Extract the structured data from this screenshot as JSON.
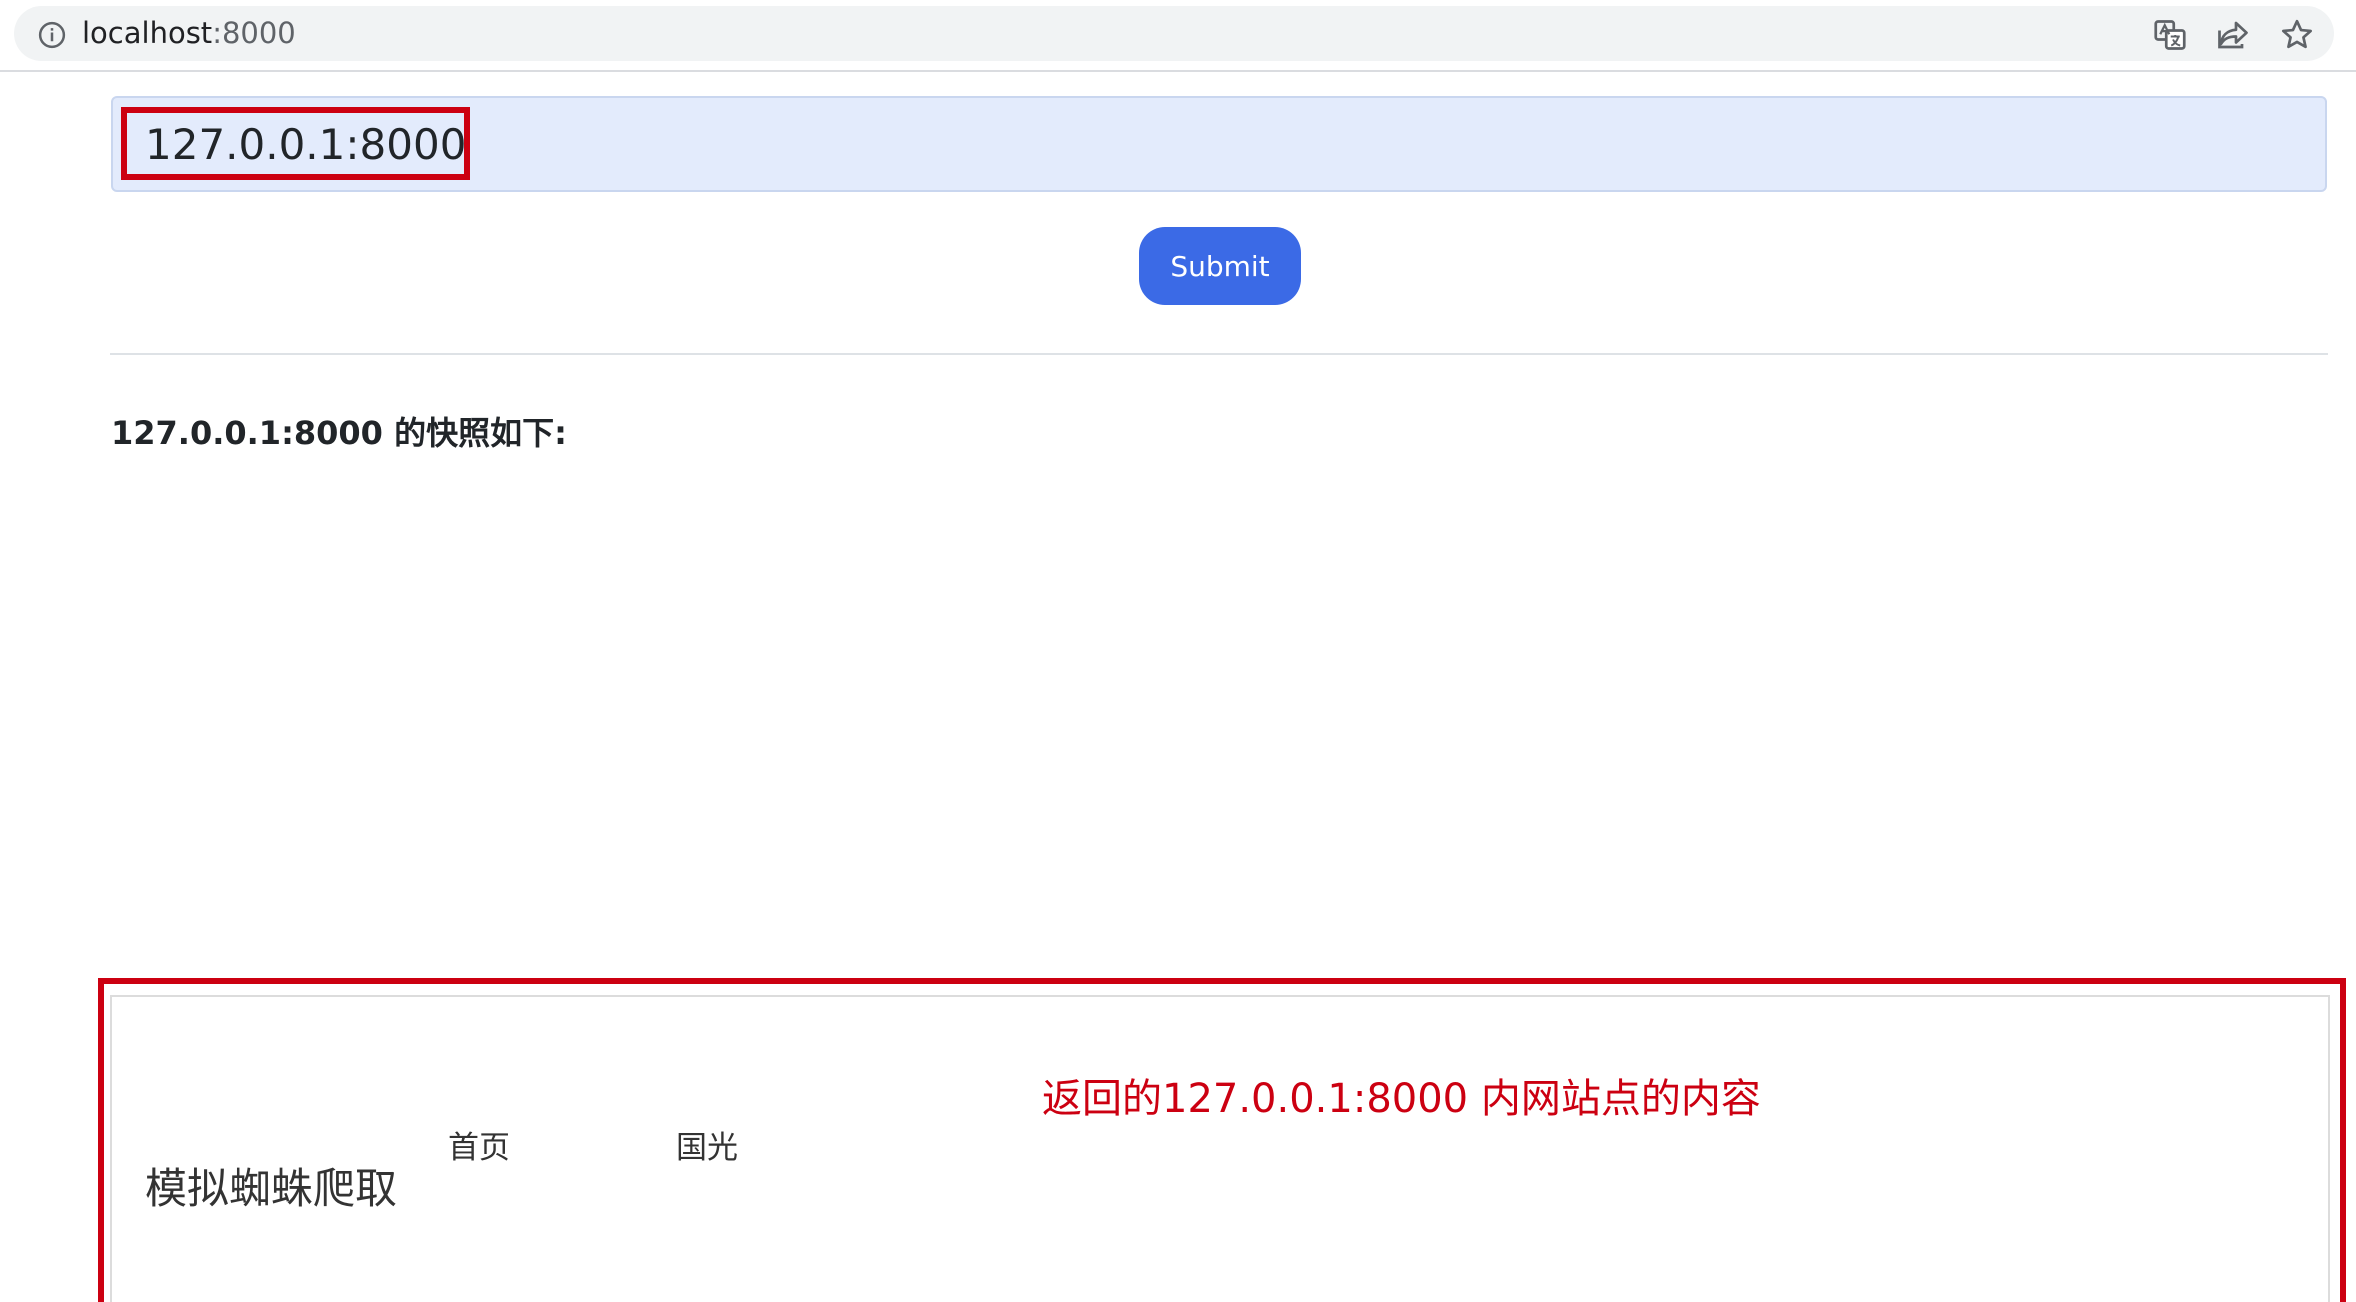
{
  "browser": {
    "url_host": "localhost",
    "url_port": ":8000",
    "icons": [
      "info-icon",
      "translate-icon",
      "share-icon",
      "star-icon"
    ]
  },
  "form": {
    "url_input_value": "127.0.0.1:8000",
    "submit_label": "Submit"
  },
  "result": {
    "heading": "127.0.0.1:8000 的快照如下:"
  },
  "snapshot": {
    "brand": "模拟蜘蛛爬取",
    "nav": [
      "首页",
      "国光"
    ],
    "annotation": "返回的127.0.0.1:8000 内网站点的内容"
  },
  "colors": {
    "accent": "#3b6ae6",
    "highlight": "#cc0011",
    "input_bg": "#e3ebfc"
  }
}
